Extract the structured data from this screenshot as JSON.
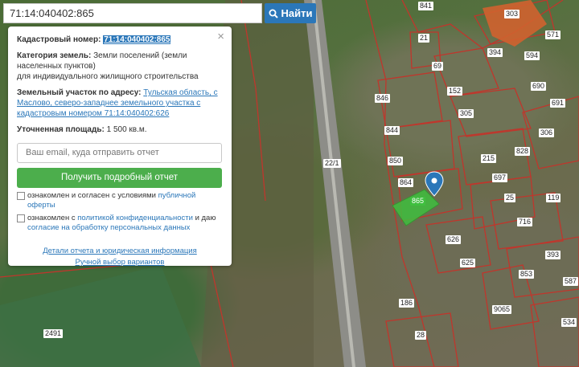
{
  "search": {
    "query": "71:14:040402:865",
    "button_label": "Найти",
    "button_icon": "search-icon"
  },
  "card": {
    "close_icon": "close-icon",
    "cadastral_label": "Кадастровый номер:",
    "cadastral_number": "71:14:040402:865",
    "category_label": "Категория земель:",
    "category_value": "Земли поселений (земли населенных пунктов)",
    "category_purpose": "для индивидуального жилищного строительства",
    "address_label": "Земельный участок по адресу:",
    "address_link": "Тульская область, с Маслово, северо-западнее земельного участка с кадастровым номером 71:14:040402:626",
    "area_label": "Уточненная площадь:",
    "area_value": "1 500 кв.м.",
    "email_placeholder": "Ваш email, куда отправить отчет",
    "report_button": "Получить подробный отчет",
    "consent1_text": "ознакомлен и согласен с условиями",
    "consent1_link": "публичной оферты",
    "consent2_text": "ознакомлен с",
    "consent2_link": "политикой конфиденциальности",
    "consent2_mid": "и даю",
    "consent2_link2": "согласие на обработку персональных данных",
    "details_link": "Детали отчета и юридическая информация",
    "manual_link": "Ручной выбор вариантов"
  },
  "map": {
    "road_label": "22/1",
    "highlight_color": "#3fbf3f",
    "boundary_color": "#c0362c",
    "marker_color": "#2b77b9",
    "parcel_labels": [
      "841",
      "303",
      "21",
      "571",
      "69",
      "394",
      "594",
      "152",
      "305",
      "846",
      "690",
      "691",
      "844",
      "306",
      "828",
      "850",
      "215",
      "697",
      "864",
      "865",
      "25",
      "119",
      "716",
      "626",
      "393",
      "625",
      "853",
      "587",
      "2491",
      "186",
      "9065",
      "534",
      "28"
    ]
  }
}
